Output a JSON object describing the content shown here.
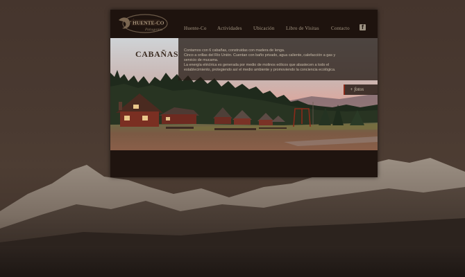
{
  "header": {
    "logo_alt": "Huente-Co Patagonia",
    "nav": [
      {
        "label": "Huente-Co"
      },
      {
        "label": "Actividades"
      },
      {
        "label": "Ubicación"
      },
      {
        "label": "Libro de Visitas"
      },
      {
        "label": "Contacto"
      }
    ],
    "facebook_icon": "facebook-icon"
  },
  "main": {
    "title": "CABAÑAS",
    "description": [
      "Contamos con 6 cabañas, construidas con madera de lenga.",
      "Cinco a orillas del Río Unión. Cuentan con baño privado, agua caliente, calefacción a gas y",
      "servicio de mucama.",
      "La energía eléctrica es generada por medio de molinos eólicos que abastecen a todo el",
      "establecimiento, protegiendo así el medio ambiente y promoviendo la conciencia ecológica."
    ],
    "photos_button": "+ fotos"
  },
  "colors": {
    "panel_bg": "#1f140f",
    "nav_text": "#a89a86",
    "accent": "#8b2a1a"
  }
}
